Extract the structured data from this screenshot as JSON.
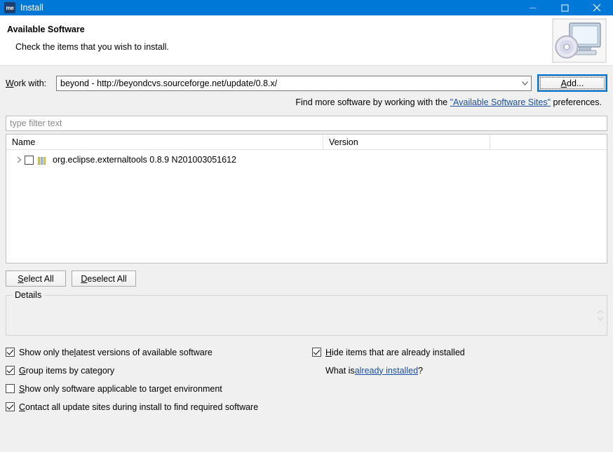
{
  "window": {
    "app_icon_label": "me",
    "title": "Install",
    "controls": {
      "minimize": "minimize-icon",
      "maximize": "maximize-icon",
      "close": "close-icon"
    },
    "titlebar_color": "#0078d7"
  },
  "header": {
    "title": "Available Software",
    "subtitle": "Check the items that you wish to install.",
    "icon": "computer-with-disc-icon"
  },
  "work_with": {
    "label_pre": "W",
    "label_post": "ork with:",
    "value": "beyond - http://beyondcvs.sourceforge.net/update/0.8.x/",
    "dropdown_icon": "chevron-down-icon",
    "add_button": {
      "label_pre": "A",
      "label_post": "dd..."
    }
  },
  "find_more": {
    "text_before": "Find more software by working with the ",
    "link": "\"Available Software Sites\"",
    "text_after": " preferences."
  },
  "filter": {
    "placeholder": "type filter text",
    "value": ""
  },
  "table": {
    "columns": [
      {
        "label": "Name"
      },
      {
        "label": "Version"
      },
      {
        "label": ""
      }
    ],
    "rows": [
      {
        "expand_icon": "chevron-right-icon",
        "checked": false,
        "item_icon": "feature-bundle-icon",
        "name": "org.eclipse.externaltools 0.8.9 N201003051612",
        "version": ""
      }
    ]
  },
  "buttons": {
    "select_all": {
      "label_pre": "S",
      "label_post": "elect All"
    },
    "deselect_all": {
      "label_pre": "D",
      "label_post": "eselect All"
    }
  },
  "details": {
    "legend": "Details",
    "content": "",
    "spinner_icon": "scroll-spinner-icon"
  },
  "options": {
    "left": [
      {
        "checked": true,
        "pre": "Show only the ",
        "acc": "l",
        "post": "atest versions of available software"
      },
      {
        "checked": true,
        "pre": "",
        "acc": "G",
        "post": "roup items by category"
      },
      {
        "checked": false,
        "pre": "",
        "acc": "S",
        "post": "how only software applicable to target environment"
      },
      {
        "checked": true,
        "pre": "",
        "acc": "C",
        "post": "ontact all update sites during install to find required software"
      }
    ],
    "right": [
      {
        "checked": true,
        "pre": "",
        "acc": "H",
        "post": "ide items that are already installed"
      }
    ],
    "what_is": {
      "text_before": "What is ",
      "link": "already installed",
      "text_after": "?"
    }
  },
  "colors": {
    "accent": "#0078d7",
    "link": "#1a4fa0",
    "dialog_bg": "#f0f0f0"
  }
}
